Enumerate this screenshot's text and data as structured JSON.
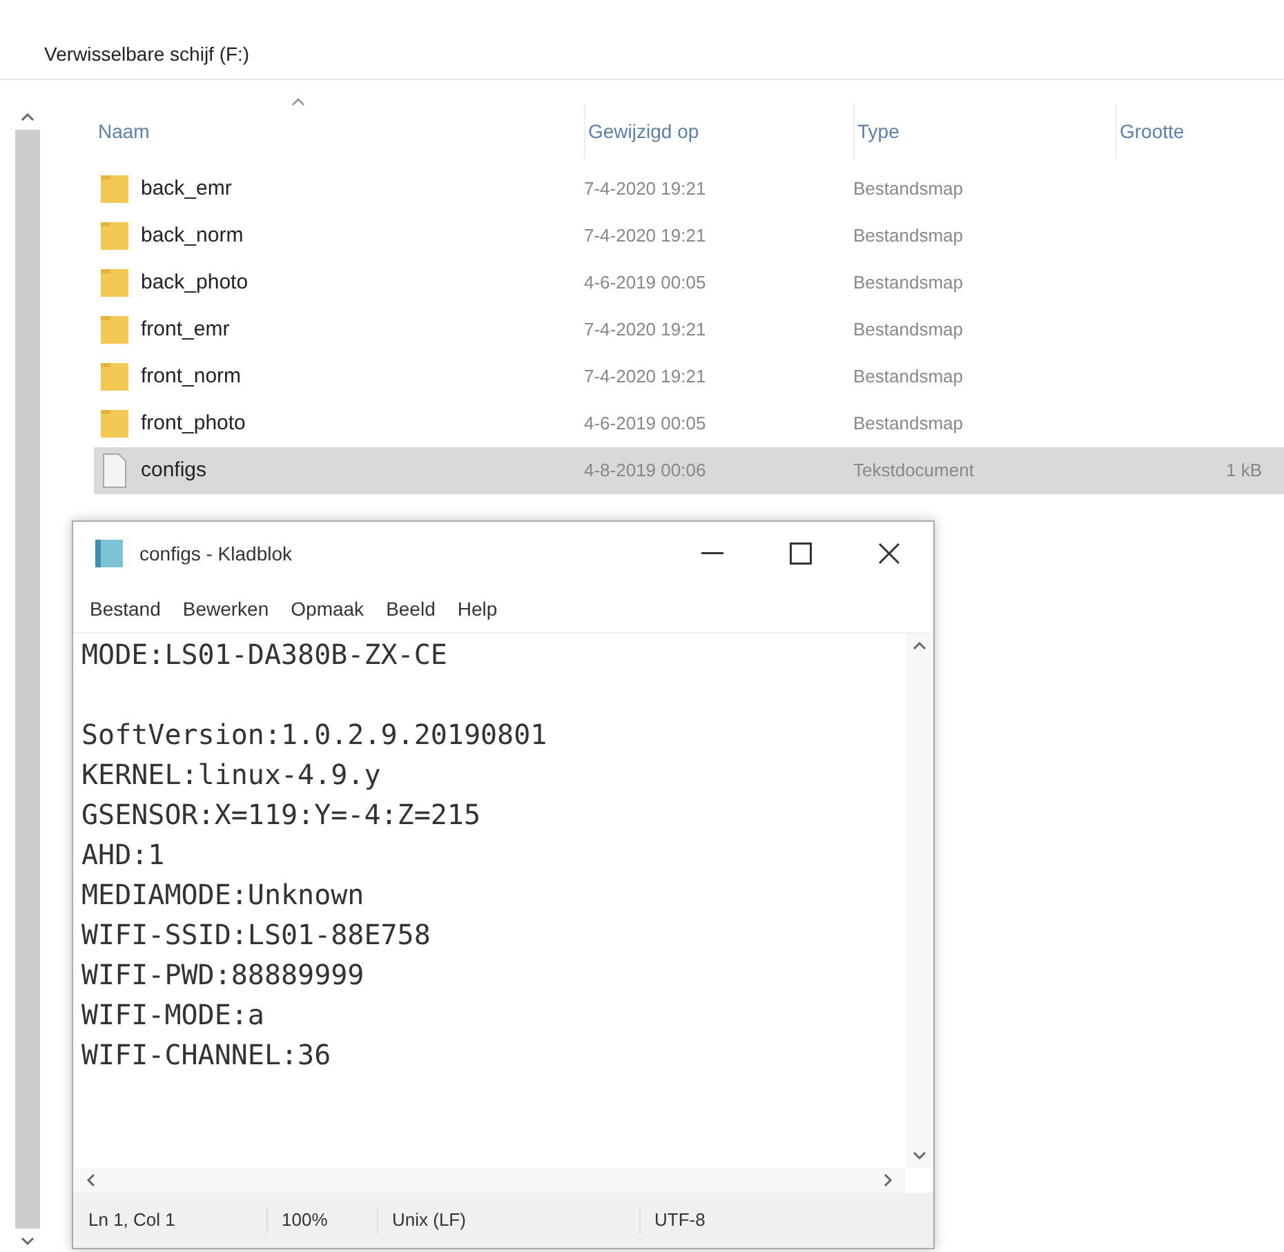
{
  "explorer": {
    "location": "Verwisselbare schijf (F:)",
    "columns": [
      {
        "label": "Naam",
        "sorted": true
      },
      {
        "label": "Gewijzigd op",
        "sorted": false
      },
      {
        "label": "Type",
        "sorted": false
      },
      {
        "label": "Grootte",
        "sorted": false
      }
    ],
    "rows": [
      {
        "kind": "folder",
        "name": "back_emr",
        "modified": "7-4-2020 19:21",
        "type": "Bestandsmap",
        "selected": false
      },
      {
        "kind": "folder",
        "name": "back_norm",
        "modified": "7-4-2020 19:21",
        "type": "Bestandsmap",
        "selected": false
      },
      {
        "kind": "folder",
        "name": "back_photo",
        "modified": "4-6-2019 00:05",
        "type": "Bestandsmap",
        "selected": false
      },
      {
        "kind": "folder",
        "name": "front_emr",
        "modified": "7-4-2020 19:21",
        "type": "Bestandsmap",
        "selected": false
      },
      {
        "kind": "folder",
        "name": "front_norm",
        "modified": "7-4-2020 19:21",
        "type": "Bestandsmap",
        "selected": false
      },
      {
        "kind": "folder",
        "name": "front_photo",
        "modified": "4-6-2019 00:05",
        "type": "Bestandsmap",
        "selected": false
      },
      {
        "kind": "file",
        "name": "configs",
        "modified": "4-8-2019 00:06",
        "type": "Tekstdocument",
        "size": "1 kB",
        "selected": true
      }
    ]
  },
  "notepad": {
    "title": "configs - Kladblok",
    "menu": [
      "Bestand",
      "Bewerken",
      "Opmaak",
      "Beeld",
      "Help"
    ],
    "paragraphs": [
      [
        "MODE:LS01-DA380B-ZX-CE"
      ],
      [
        "SoftVersion:1.0.2.9.20190801",
        "KERNEL:linux-4.9.y",
        "GSENSOR:X=119:Y=-4:Z=215",
        "AHD:1",
        "MEDIAMODE:Unknown",
        "WIFI-SSID:LS01-88E758",
        "WIFI-PWD:88889999",
        "WIFI-MODE:a",
        "WIFI-CHANNEL:36"
      ]
    ],
    "status": [
      "Ln 1, Col 1",
      "100%",
      "Unix (LF)",
      "UTF-8"
    ]
  }
}
